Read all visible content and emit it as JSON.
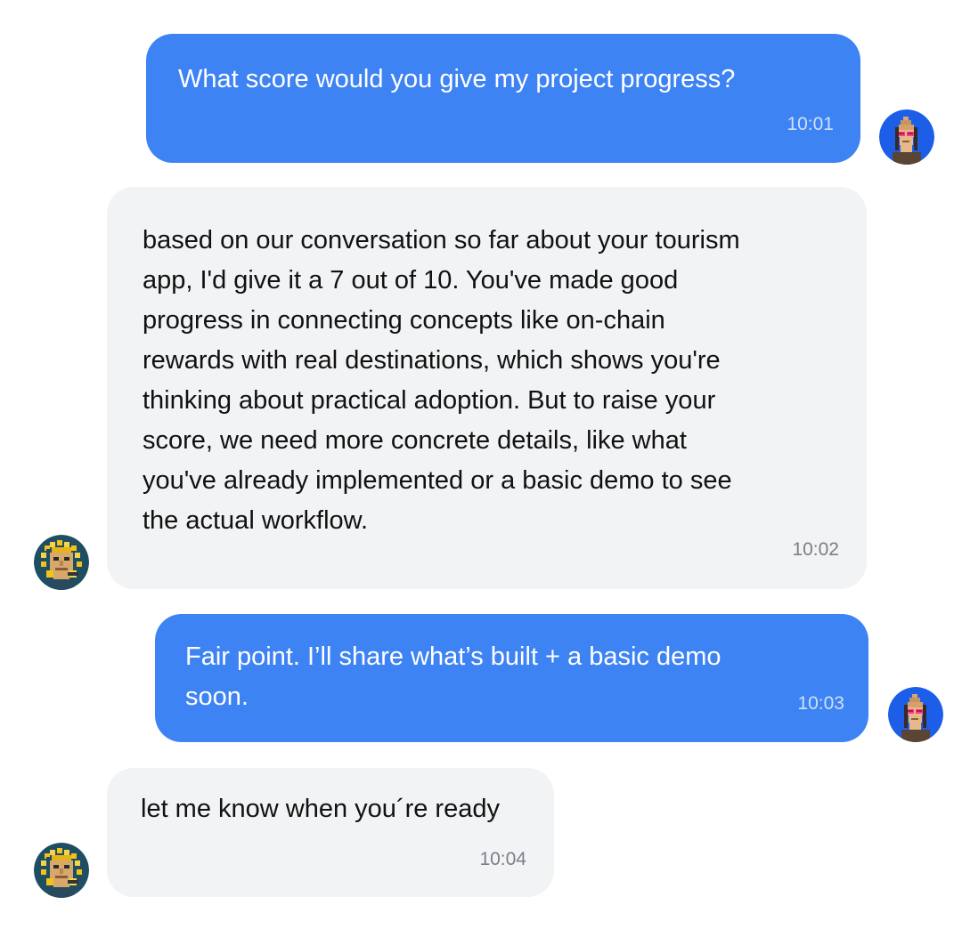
{
  "messages": [
    {
      "sender": "user",
      "text": "What score would you give my project progress?",
      "time": "10:01"
    },
    {
      "sender": "assistant",
      "text": "based on our conversation so far about your tourism\napp, I'd give it a 7 out of 10. You've made good\nprogress in connecting concepts like on-chain\nrewards with real destinations, which shows you're\nthinking about practical adoption. But to raise your\nscore, we need more concrete details, like what\nyou've already implemented or a basic demo to see\nthe actual workflow.",
      "time": "10:02"
    },
    {
      "sender": "user",
      "text": "Fair point. I’ll share what’s built + a basic demo\nsoon.",
      "time": "10:03"
    },
    {
      "sender": "assistant",
      "text": "let me know when you´re ready",
      "time": "10:04"
    }
  ],
  "colors": {
    "outgoing_bubble": "#3d83f3",
    "incoming_bubble": "#f2f3f5",
    "user_avatar_bg": "#1d5ee8",
    "assistant_avatar_bg": "#1f4e63"
  },
  "avatars": {
    "user": "pixel-punk-avatar-icon",
    "assistant": "pixel-medusa-avatar-icon"
  }
}
